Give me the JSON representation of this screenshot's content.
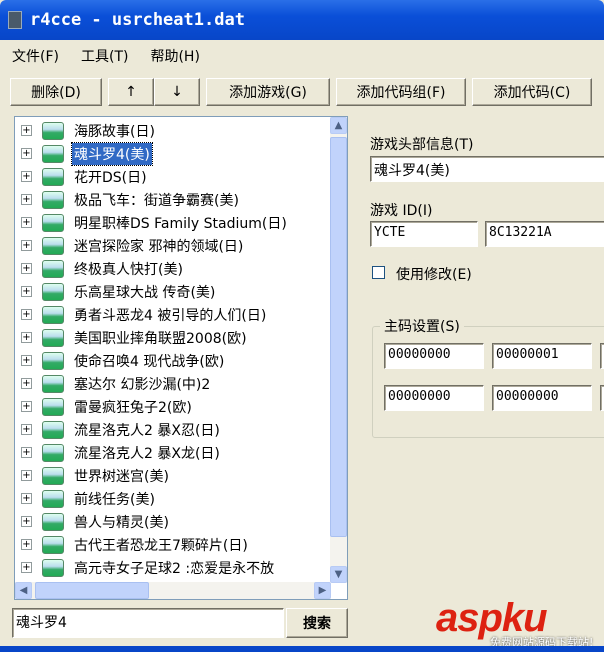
{
  "window": {
    "title": "r4cce - usrcheat1.dat"
  },
  "menu": [
    "文件(F)",
    "工具(T)",
    "帮助(H)"
  ],
  "toolbar": {
    "delete": "删除(D)",
    "up": "↑",
    "down": "↓",
    "add_game": "添加游戏(G)",
    "add_group": "添加代码组(F)",
    "add_code": "添加代码(C)"
  },
  "tree": {
    "items": [
      "海豚故事(日)",
      "魂斗罗4(美)",
      "花开DS(日)",
      "极品飞车：街道争霸赛(美)",
      "明星职棒DS Family Stadium(日)",
      "迷宫探险家 邪神的领域(日)",
      "终极真人快打(美)",
      "乐高星球大战 传奇(美)",
      "勇者斗恶龙4 被引导的人们(日)",
      "美国职业摔角联盟2008(欧)",
      "使命召唤4 现代战争(欧)",
      "塞达尔 幻影沙漏(中)2",
      "雷曼疯狂兔子2(欧)",
      "流星洛克人2 暴X忍(日)",
      "流星洛克人2 暴X龙(日)",
      "世界树迷宫(美)",
      "前线任务(美)",
      "兽人与精灵(美)",
      "古代王者恐龙王7颗碎片(日)",
      "高元寺女子足球2 :恋爱是永不放"
    ],
    "selected": 1
  },
  "search": {
    "value": "魂斗罗4",
    "button": "搜索"
  },
  "detail": {
    "header_label": "游戏头部信息(T)",
    "header_value": "魂斗罗4(美)",
    "id_label": "游戏 ID(I)",
    "id_value": "YCTE",
    "crc_value": "8C13221A",
    "use_label": "使用修改(E)",
    "use_checked": false,
    "master_label": "主码设置(S)",
    "master_codes": [
      [
        "00000000",
        "00000001"
      ],
      [
        "00000000",
        "00000000"
      ]
    ]
  },
  "watermark": {
    "logo": "aspku",
    "tagline": "免费网站源码下载站!"
  }
}
